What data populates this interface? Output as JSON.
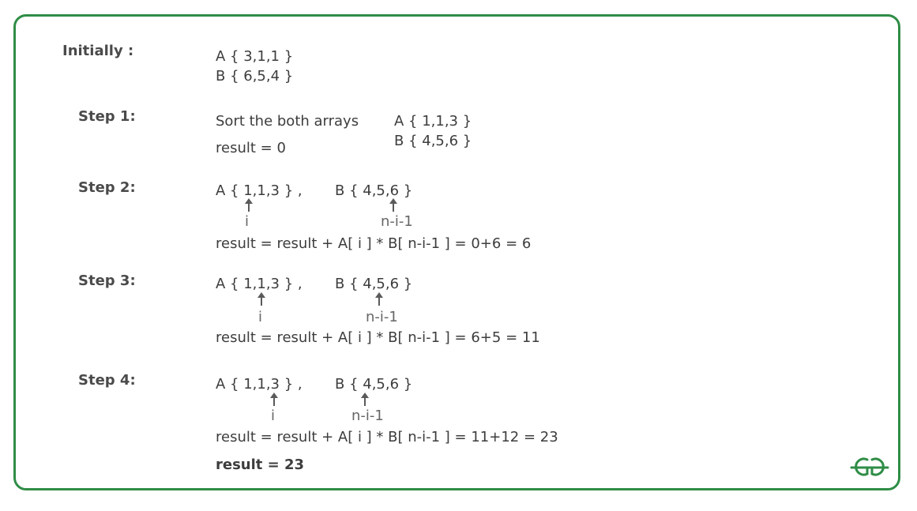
{
  "initial": {
    "label": "Initially :",
    "a": "A { 3,1,1 }",
    "b": "B { 6,5,4 }"
  },
  "steps": [
    {
      "label": "Step 1:",
      "desc": "Sort the both arrays",
      "result": "result = 0",
      "a": "A { 1,1,3 }",
      "b": "B { 4,5,6 }"
    },
    {
      "label": "Step 2:",
      "a": "A { 1,1,3 } ,",
      "b": "B { 4,5,6 }",
      "ptr_i": "i",
      "ptr_j": "n-i-1",
      "result": "result = result + A[ i ] * B[ n-i-1 ] = 0+6 = 6"
    },
    {
      "label": "Step 3:",
      "a": "A { 1,1,3 } ,",
      "b": "B { 4,5,6 }",
      "ptr_i": "i",
      "ptr_j": "n-i-1",
      "result": "result = result + A[ i ] * B[ n-i-1 ] = 6+5 = 11"
    },
    {
      "label": "Step 4:",
      "a": "A { 1,1,3 } ,",
      "b": "B { 4,5,6 }",
      "ptr_i": "i",
      "ptr_j": "n-i-1",
      "result": "result = result + A[ i ] * B[ n-i-1 ] = 11+12 = 23"
    }
  ],
  "final": "result = 23",
  "colors": {
    "border": "#2f8d46",
    "text": "#3d3d3d",
    "logo": "#2f8d46"
  },
  "logo_icon": "gfg-logo"
}
